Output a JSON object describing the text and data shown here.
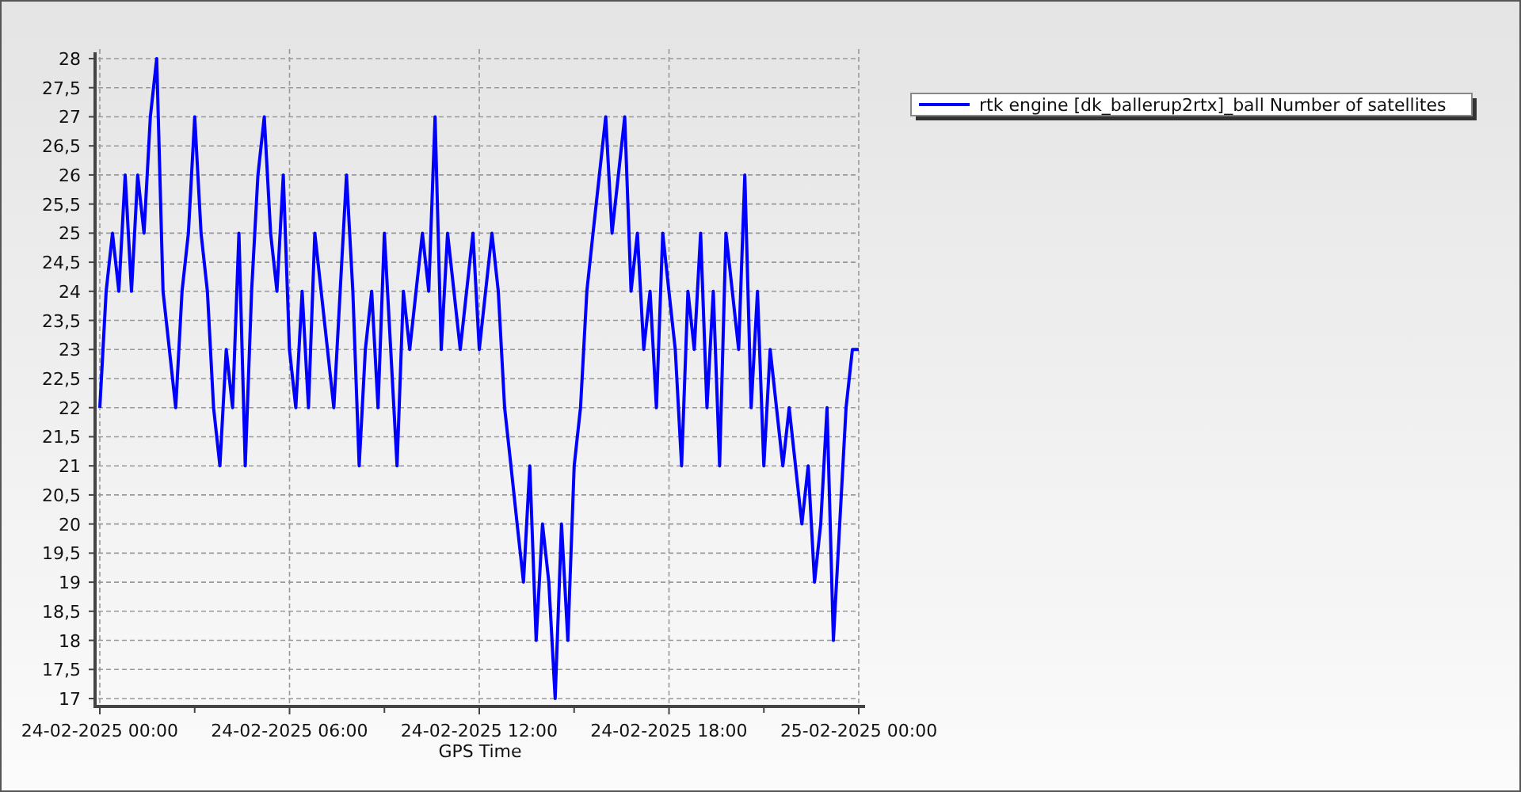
{
  "chart": {
    "chart_data": {
      "type": "line",
      "xlabel": "GPS Time",
      "categories": [
        "24-02-2025 00:00",
        null,
        null,
        null,
        null,
        null,
        null,
        null,
        null,
        null,
        null,
        null,
        null,
        null,
        null,
        null,
        null,
        null,
        null,
        null,
        null,
        null,
        null,
        null,
        null,
        null,
        null,
        null,
        null,
        null,
        "24-02-2025 06:00",
        null,
        null,
        null,
        null,
        null,
        null,
        null,
        null,
        null,
        null,
        null,
        null,
        null,
        null,
        null,
        null,
        null,
        null,
        null,
        null,
        null,
        null,
        null,
        null,
        null,
        null,
        null,
        null,
        null,
        "24-02-2025 12:00",
        null,
        null,
        null,
        null,
        null,
        null,
        null,
        null,
        null,
        null,
        null,
        null,
        null,
        null,
        null,
        null,
        null,
        null,
        null,
        null,
        null,
        null,
        null,
        null,
        null,
        null,
        null,
        null,
        null,
        "24-02-2025 18:00",
        null,
        null,
        null,
        null,
        null,
        null,
        null,
        null,
        null,
        null,
        null,
        null,
        null,
        null,
        null,
        null,
        null,
        null,
        null,
        null,
        null,
        null,
        null,
        null,
        null,
        null,
        null,
        null,
        null,
        "25-02-2025 00:00"
      ],
      "series": [
        {
          "name": "rtk engine [dk_ballerup2rtx]_ball Number of satellites",
          "color": "#0000ff",
          "values": [
            22,
            24,
            25,
            24,
            26,
            24,
            26,
            25,
            27,
            28,
            24,
            23,
            22,
            24,
            25,
            27,
            25,
            24,
            22,
            21,
            23,
            22,
            25,
            21,
            24,
            26,
            27,
            25,
            24,
            26,
            23,
            22,
            24,
            22,
            25,
            24,
            23,
            22,
            24,
            26,
            24,
            21,
            23,
            24,
            22,
            25,
            23,
            21,
            24,
            23,
            24,
            25,
            24,
            27,
            23,
            25,
            24,
            23,
            24,
            25,
            23,
            24,
            25,
            24,
            22,
            21,
            20,
            19,
            21,
            18,
            20,
            19,
            17,
            20,
            18,
            21,
            22,
            24,
            25,
            26,
            27,
            25,
            26,
            27,
            24,
            25,
            23,
            24,
            22,
            25,
            24,
            23,
            21,
            24,
            23,
            25,
            22,
            24,
            21,
            25,
            24,
            23,
            26,
            22,
            24,
            21,
            23,
            22,
            21,
            22,
            21,
            20,
            21,
            19,
            20,
            22,
            18,
            20,
            22,
            23,
            23
          ]
        }
      ],
      "ylim": [
        17,
        28
      ],
      "grid": true,
      "yticks": [
        {
          "value": 17,
          "label": "17"
        },
        {
          "value": 17.5,
          "label": "17,5"
        },
        {
          "value": 18,
          "label": "18"
        },
        {
          "value": 18.5,
          "label": "18,5"
        },
        {
          "value": 19,
          "label": "19"
        },
        {
          "value": 19.5,
          "label": "19,5"
        },
        {
          "value": 20,
          "label": "20"
        },
        {
          "value": 20.5,
          "label": "20,5"
        },
        {
          "value": 21,
          "label": "21"
        },
        {
          "value": 21.5,
          "label": "21,5"
        },
        {
          "value": 22,
          "label": "22"
        },
        {
          "value": 22.5,
          "label": "22,5"
        },
        {
          "value": 23,
          "label": "23"
        },
        {
          "value": 23.5,
          "label": "23,5"
        },
        {
          "value": 24,
          "label": "24"
        },
        {
          "value": 24.5,
          "label": "24,5"
        },
        {
          "value": 25,
          "label": "25"
        },
        {
          "value": 25.5,
          "label": "25,5"
        },
        {
          "value": 26,
          "label": "26"
        },
        {
          "value": 26.5,
          "label": "26,5"
        },
        {
          "value": 27,
          "label": "27"
        },
        {
          "value": 27.5,
          "label": "27,5"
        },
        {
          "value": 28,
          "label": "28"
        }
      ]
    }
  }
}
